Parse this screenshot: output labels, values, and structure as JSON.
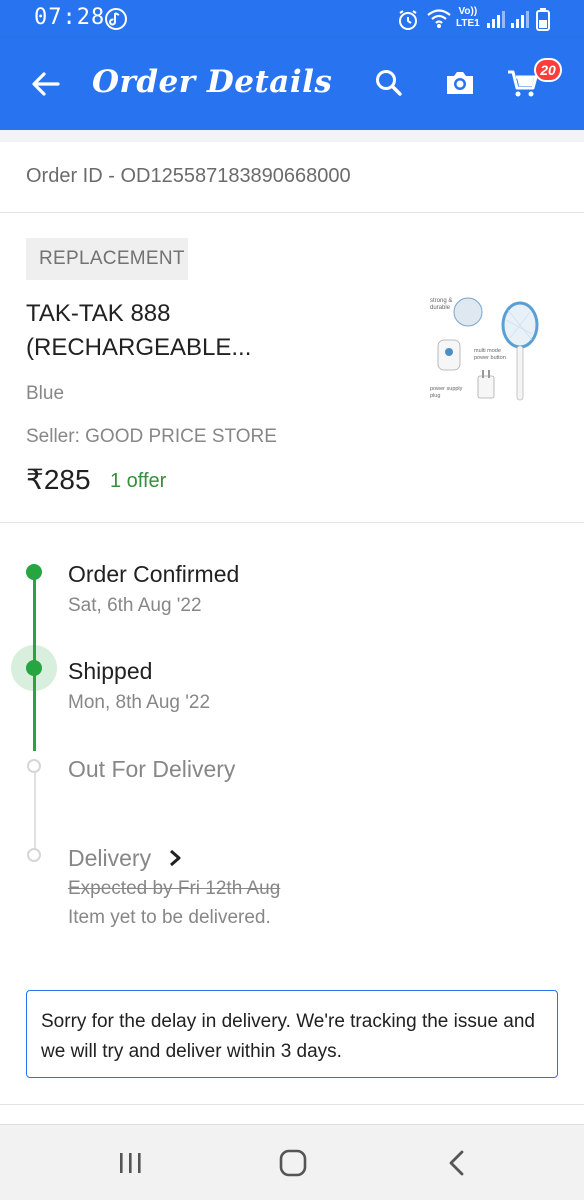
{
  "status_bar": {
    "time": "07:28",
    "network_label_top": "Vo))",
    "network_label_bottom": "LTE1"
  },
  "header": {
    "title": "Order Details",
    "cart_count": "20",
    "icons": [
      "back-arrow-icon",
      "search-icon",
      "camera-icon",
      "cart-icon"
    ]
  },
  "order": {
    "id_text": "Order ID - OD125587183890668000"
  },
  "product": {
    "badge": "REPLACEMENT",
    "title_line1": "TAK-TAK 888",
    "title_line2": "(RECHARGEABLE...",
    "color": "Blue",
    "seller": "Seller: GOOD PRICE STORE",
    "price": "₹285",
    "offer": "1 offer",
    "image_labels": [
      "strong & durable",
      "multi mode power button",
      "power supply plug"
    ]
  },
  "timeline": {
    "steps": [
      {
        "label": "Order Confirmed",
        "date": "Sat, 6th Aug '22",
        "status": "done"
      },
      {
        "label": "Shipped",
        "date": "Mon, 8th Aug '22",
        "status": "current"
      },
      {
        "label": "Out For Delivery",
        "date": "",
        "status": "pending"
      },
      {
        "label": "Delivery",
        "expected": "Expected by Fri 12th Aug",
        "note": "Item yet to be delivered.",
        "status": "pending"
      }
    ],
    "colors": {
      "done": "#26a541",
      "pending": "#d6d6d6"
    }
  },
  "notice": {
    "text": "Sorry for the delay in delivery. We're tracking the issue and we will try and deliver within 3 days."
  },
  "colors": {
    "brand": "#2874f0",
    "success": "#26a541",
    "badge_red": "#ff3b3b"
  }
}
